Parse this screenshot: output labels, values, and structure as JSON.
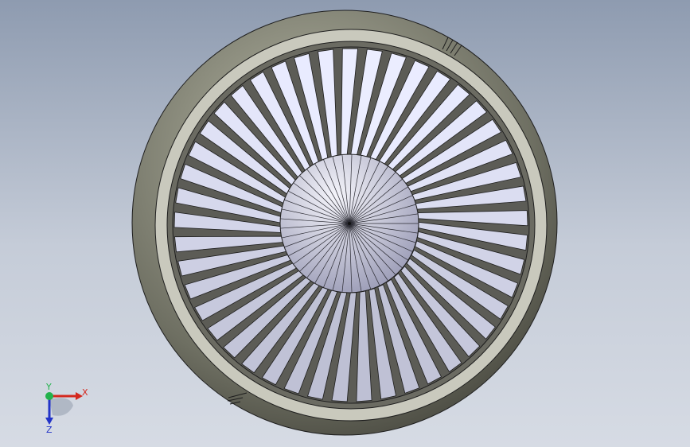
{
  "viewport": {
    "background_top": "#8e9bb0",
    "background_bottom": "#d6dbe4"
  },
  "model": {
    "name": "fan-impeller",
    "blade_count": 45,
    "hub_spoke_count": 45,
    "colors": {
      "outer_shell_light": "#b9baa8",
      "outer_shell_dark": "#3f3f37",
      "ring_face": "#c9c9bd",
      "inner_ring": "#6b6b62",
      "blade_light": "#eceef8",
      "blade_dark": "#8e90c4",
      "hub_light": "#eeeef6",
      "hub_dark": "#8f90ac",
      "edge": "#1e1e1e"
    }
  },
  "triad": {
    "x_label": "X",
    "y_label": "Y",
    "z_label": "Z",
    "x_color": "#d4281e",
    "y_color": "#22b24c",
    "z_color": "#2233c8"
  }
}
